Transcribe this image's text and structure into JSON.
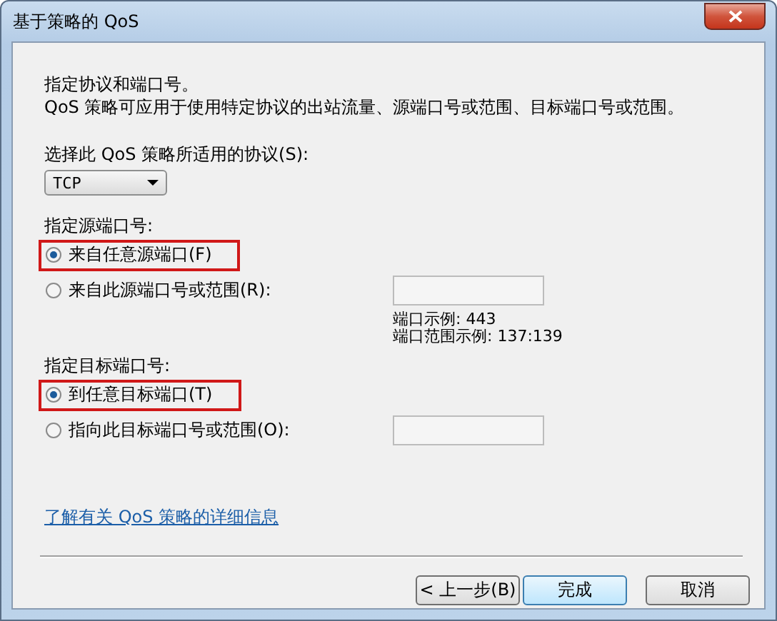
{
  "window": {
    "title": "基于策略的 QoS"
  },
  "intro": {
    "heading": "指定协议和端口号。",
    "description": "QoS 策略可应用于使用特定协议的出站流量、源端口号或范围、目标端口号或范围。"
  },
  "protocol": {
    "label": "选择此 QoS 策略所适用的协议(S):",
    "value": "TCP"
  },
  "source": {
    "label": "指定源端口号:",
    "options": [
      {
        "label": "来自任意源端口(F)",
        "selected": true,
        "highlighted": true,
        "kind": "plain"
      },
      {
        "label": "来自此源端口号或范围(R):",
        "selected": false,
        "highlighted": false,
        "kind": "field"
      }
    ],
    "examples": [
      "端口示例: 443",
      "端口范围示例: 137:139"
    ]
  },
  "destination": {
    "label": "指定目标端口号:",
    "options": [
      {
        "label": "到任意目标端口(T)",
        "selected": true,
        "highlighted": true,
        "kind": "plain"
      },
      {
        "label": "指向此目标端口号或范围(O):",
        "selected": false,
        "highlighted": false,
        "kind": "field"
      }
    ]
  },
  "link": "了解有关 QoS 策略的详细信息",
  "buttons": [
    {
      "label": "< 上一步(B)",
      "default": false
    },
    {
      "label": "完成",
      "default": true
    },
    {
      "label": "取消",
      "default": false
    }
  ]
}
